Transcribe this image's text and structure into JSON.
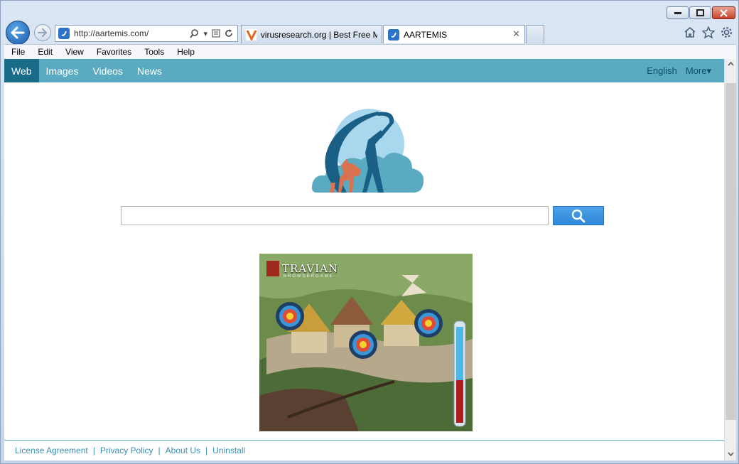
{
  "browser": {
    "address": "http://aartemis.com/",
    "tabs": [
      {
        "title": "virusresearch.org | Best Free M...",
        "favicon": "v-icon"
      },
      {
        "title": "AARTEMIS",
        "favicon": "aartemis-favicon"
      }
    ]
  },
  "menubar": {
    "items": [
      "File",
      "Edit",
      "View",
      "Favorites",
      "Tools",
      "Help"
    ]
  },
  "nav": {
    "tabs": [
      "Web",
      "Images",
      "Videos",
      "News"
    ],
    "active": "Web",
    "language": "English",
    "more": "More▾"
  },
  "search": {
    "value": "",
    "button_icon": "search-icon"
  },
  "ad": {
    "brand": "TRAVIAN",
    "tagline": "BROWSERGAME"
  },
  "footer": {
    "links": [
      "License Agreement",
      "Privacy Policy",
      "About Us",
      "Uninstall"
    ],
    "separator": "|"
  },
  "colors": {
    "nav_bar": "#5aabc1",
    "nav_active": "#186c88",
    "search_button": "#3b93dd",
    "footer_link": "#3d8fb0"
  }
}
